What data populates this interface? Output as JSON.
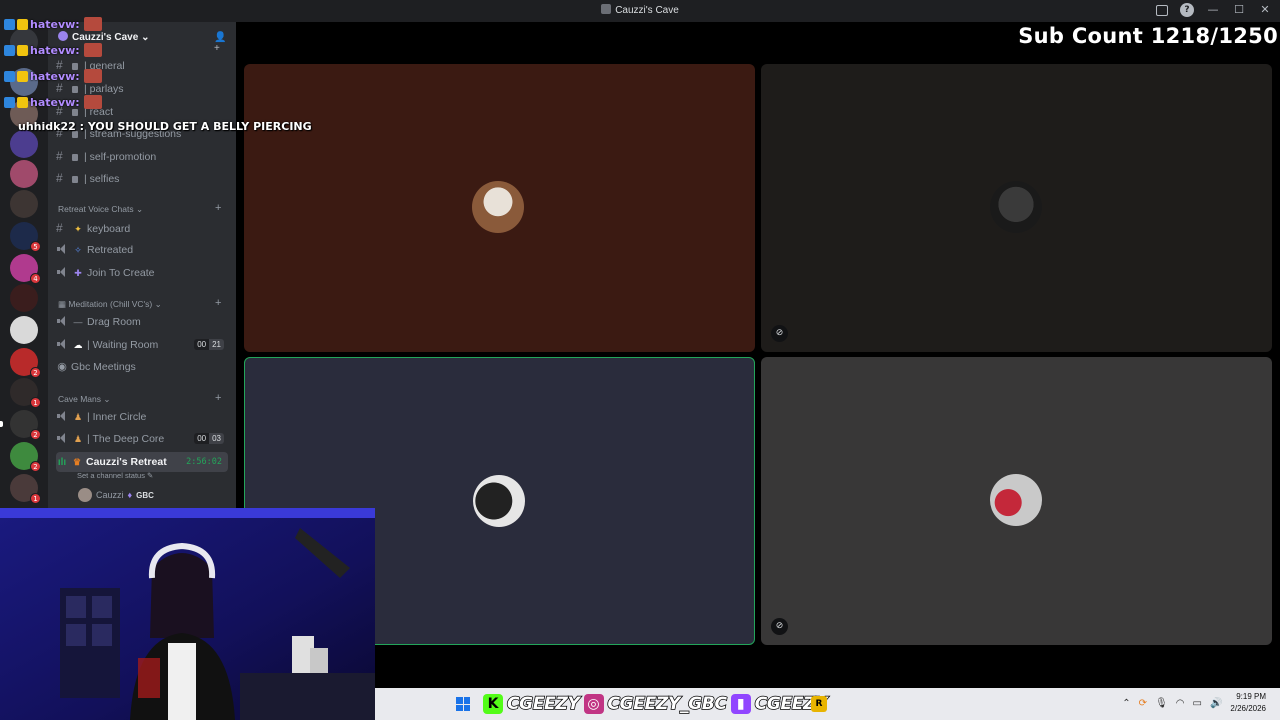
{
  "window": {
    "title": "Cauzzi's Cave"
  },
  "overlay": {
    "sub_count": "Sub Count 1218/1250",
    "chat": [
      {
        "name": "hatevw:"
      },
      {
        "name": "hatevw:"
      },
      {
        "name": "hatevw:"
      },
      {
        "name": "hatevw:"
      }
    ],
    "last_message": "uhhidk22 : YOU SHOULD GET A BELLY PIERCING"
  },
  "sidebar": {
    "server_name": "Cauzzi's Cave",
    "channels_top": [
      {
        "name": "| general"
      },
      {
        "name": "| parlays"
      },
      {
        "name": "| react"
      },
      {
        "name": "| stream-suggestions"
      },
      {
        "name": "| self-promotion"
      },
      {
        "name": "| selfies"
      }
    ],
    "categories": {
      "retreat": "Retreat Voice Chats",
      "meditation": "Meditation (Chill VC's)",
      "cave_mans": "Cave Mans"
    },
    "retreat_channels": [
      {
        "name": "keyboard"
      },
      {
        "name": "Retreated"
      },
      {
        "name": "Join To Create"
      }
    ],
    "meditation_channels": [
      {
        "name": "Drag Room"
      },
      {
        "name": "| Waiting Room",
        "count_a": "00",
        "count_b": "21"
      },
      {
        "name": "Gbc Meetings"
      }
    ],
    "cave_channels": [
      {
        "name": "| Inner Circle"
      },
      {
        "name": "| The Deep Core",
        "count_a": "00",
        "count_b": "03"
      },
      {
        "name": "Cauzzi's Retreat",
        "timer": "2:56:02"
      }
    ],
    "channel_status": "Set a channel status",
    "member": {
      "name": "Cauzzi",
      "tag": "GBC"
    }
  },
  "rail_badges": [
    "5",
    "4",
    "2",
    "2",
    "1",
    "2",
    "2",
    "1"
  ],
  "taskbar": {
    "socials": [
      {
        "handle": "CGEEZY"
      },
      {
        "handle": "CGEEZY_GBC"
      },
      {
        "handle": "CGEEZY"
      }
    ],
    "time": "9:19 PM",
    "date": "2/26/2026"
  },
  "colors": {
    "accent_green": "#23a55a",
    "chat_name": "#b18cff",
    "tile_1": "#3b1a12",
    "tile_2": "#1e1c1a",
    "tile_3": "#2a2c3c",
    "tile_4": "#383737"
  }
}
